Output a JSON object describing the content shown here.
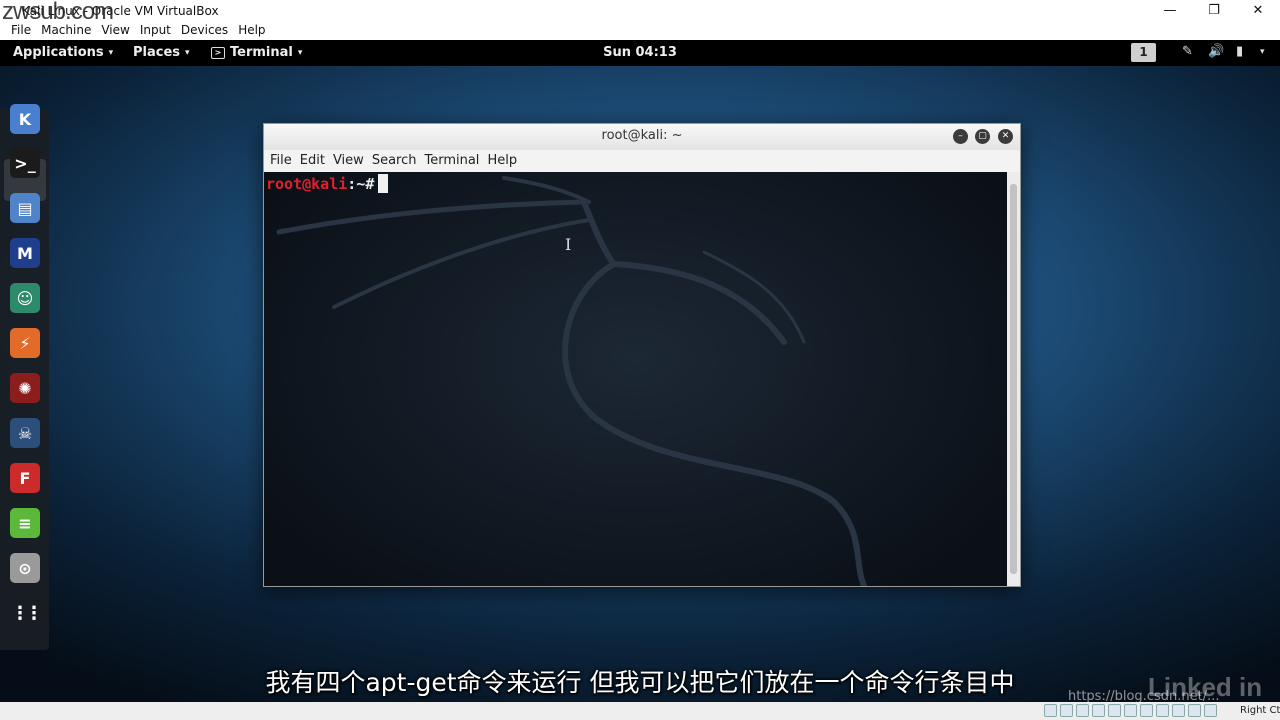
{
  "vbox": {
    "title": "Kali Linux - Oracle VM VirtualBox",
    "watermark": "zwsub.com",
    "menu": [
      "File",
      "Machine",
      "View",
      "Input",
      "Devices",
      "Help"
    ],
    "controls": {
      "minimize": "—",
      "maximize": "❐",
      "close": "✕"
    },
    "host_key": "Right Ctrl"
  },
  "gnome": {
    "applications": "Applications",
    "places": "Places",
    "terminal": "Terminal",
    "caret": "▾",
    "clock": "Sun 04:13",
    "workspace": "1",
    "tray": {
      "tools": "✎",
      "volume": "🔊",
      "battery": "▮",
      "caret": "▾"
    }
  },
  "dock": [
    {
      "name": "kali-menu-icon",
      "color": "#4a7fd0",
      "glyph": "K"
    },
    {
      "name": "terminal-icon",
      "color": "#1b1b1b",
      "glyph": ">_"
    },
    {
      "name": "files-icon",
      "color": "#4f85c8",
      "glyph": "▤"
    },
    {
      "name": "metasploit-icon",
      "color": "#1f3f8c",
      "glyph": "M"
    },
    {
      "name": "armitage-icon",
      "color": "#2d8a6b",
      "glyph": "☺"
    },
    {
      "name": "burpsuite-icon",
      "color": "#e36b2a",
      "glyph": "⚡"
    },
    {
      "name": "beef-icon",
      "color": "#8c1d1d",
      "glyph": "✺"
    },
    {
      "name": "leafpad-icon",
      "color": "#2b4f7a",
      "glyph": "☠"
    },
    {
      "name": "faraday-icon",
      "color": "#cc2b2b",
      "glyph": "F"
    },
    {
      "name": "notes-icon",
      "color": "#5bb83a",
      "glyph": "≡"
    },
    {
      "name": "screenshot-icon",
      "color": "#9a9a9a",
      "glyph": "⊙"
    },
    {
      "name": "show-apps-icon",
      "color": "transparent",
      "glyph": "⋮⋮"
    }
  ],
  "terminal_window": {
    "title": "root@kali: ~",
    "menu": [
      "File",
      "Edit",
      "View",
      "Search",
      "Terminal",
      "Help"
    ],
    "prompt_user": "root@kali",
    "prompt_rest": ":~#",
    "controls": {
      "minimize": "–",
      "maximize": "▢",
      "close": "✕"
    }
  },
  "subtitle": "我有四个apt-get命令来运行 但我可以把它们放在一个命令行条目中",
  "watermarks": {
    "blog": "https://blog.csdn.net/...",
    "linkedin": "Linked in"
  }
}
